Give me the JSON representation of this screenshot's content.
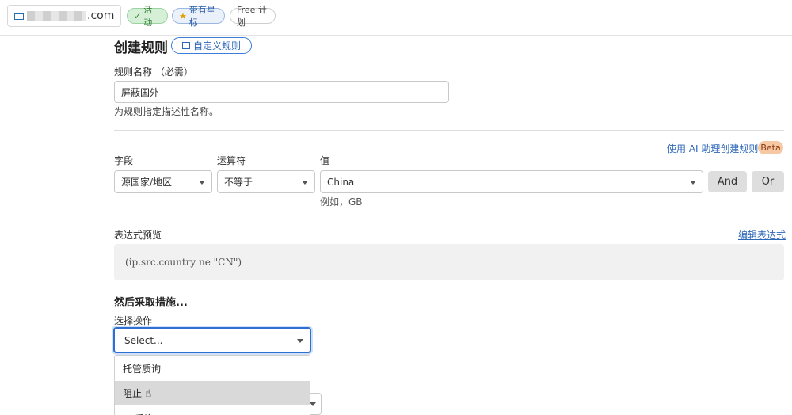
{
  "topbar": {
    "domain_suffix": ".com",
    "badge_active": "活动",
    "badge_starred": "带有星标",
    "badge_plan": "Free 计划"
  },
  "header": {
    "title": "创建规则",
    "custom_rule_button": "自定义规则"
  },
  "rule_name": {
    "label": "规则名称 （必需）",
    "value": "屏蔽国外",
    "hint": "为规则指定描述性名称。"
  },
  "ai_helper": {
    "label": "使用 AI 助理创建规则",
    "badge": "Beta"
  },
  "filter": {
    "field_label": "字段",
    "operator_label": "运算符",
    "value_label": "值",
    "field_value": "源国家/地区",
    "operator_value": "不等于",
    "value_value": "China",
    "value_hint": "例如，GB",
    "and_button": "And",
    "or_button": "Or"
  },
  "expression": {
    "label": "表达式预览",
    "edit_link": "编辑表达式",
    "preview": "(ip.src.country ne \"CN\")"
  },
  "action": {
    "section_title": "然后采取措施...",
    "select_label": "选择操作",
    "select_placeholder": "Select...",
    "options": [
      "托管质询",
      "阻止",
      "JS 质询"
    ]
  }
}
